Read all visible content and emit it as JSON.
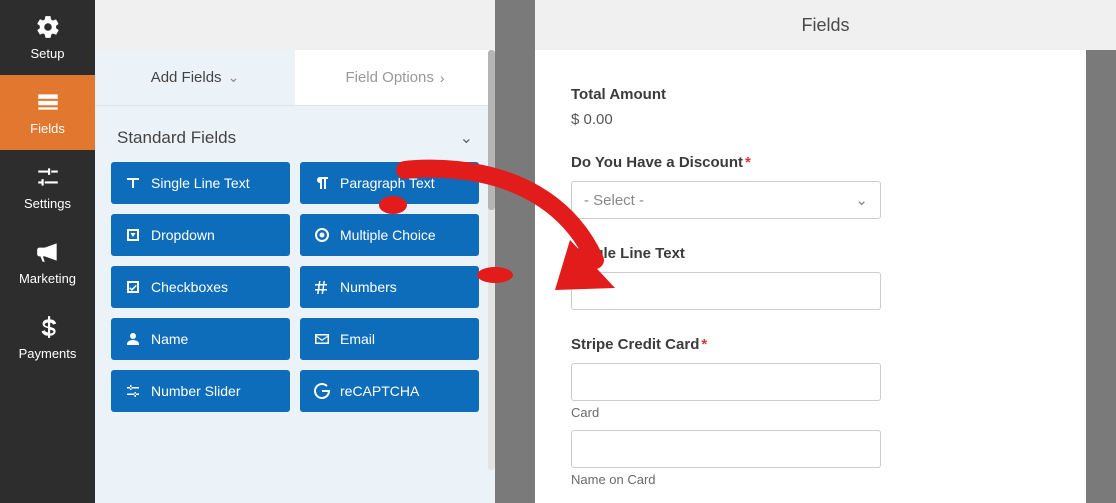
{
  "sidebar": {
    "items": [
      {
        "label": "Setup"
      },
      {
        "label": "Fields"
      },
      {
        "label": "Settings"
      },
      {
        "label": "Marketing"
      },
      {
        "label": "Payments"
      }
    ]
  },
  "panel": {
    "tab_add_fields": "Add Fields",
    "tab_field_options": "Field Options",
    "section_title": "Standard Fields"
  },
  "fields": [
    {
      "label": "Single Line Text"
    },
    {
      "label": "Paragraph Text"
    },
    {
      "label": "Dropdown"
    },
    {
      "label": "Multiple Choice"
    },
    {
      "label": "Checkboxes"
    },
    {
      "label": "Numbers"
    },
    {
      "label": "Name"
    },
    {
      "label": "Email"
    },
    {
      "label": "Number Slider"
    },
    {
      "label": "reCAPTCHA"
    }
  ],
  "preview": {
    "header": "Fields",
    "total_label": "Total Amount",
    "total_value": "$ 0.00",
    "discount_label": "Do You Have a Discount",
    "discount_required": "*",
    "select_placeholder": "- Select -",
    "slt_label": "Single Line Text",
    "stripe_label": "Stripe Credit Card",
    "stripe_required": "*",
    "card_sub": "Card",
    "name_on_card_sub": "Name on Card"
  }
}
